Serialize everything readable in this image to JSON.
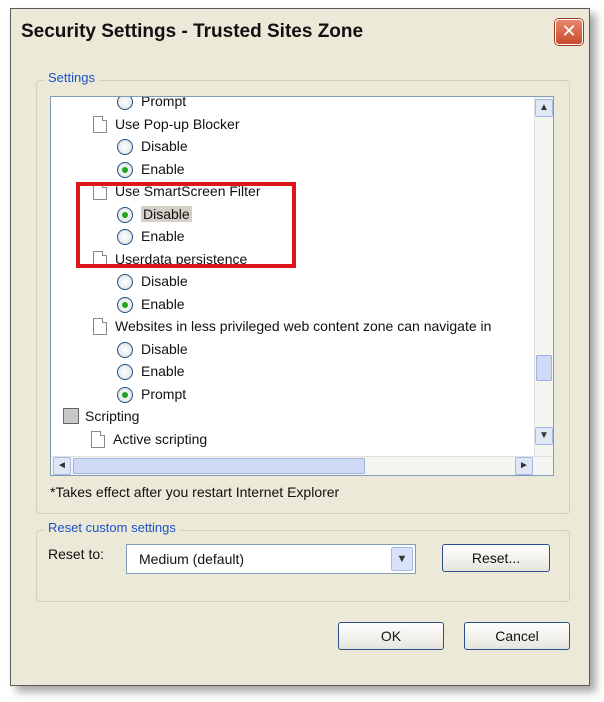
{
  "dialog": {
    "title": "Security Settings - Trusted Sites Zone",
    "close_label": "✕"
  },
  "settings": {
    "legend": "Settings",
    "items": [
      {
        "type": "radio",
        "label": "Prompt",
        "checked": false
      },
      {
        "type": "group",
        "label": "Use Pop-up Blocker"
      },
      {
        "type": "radio",
        "label": "Disable",
        "checked": false
      },
      {
        "type": "radio",
        "label": "Enable",
        "checked": true
      },
      {
        "type": "group",
        "label": "Use SmartScreen Filter"
      },
      {
        "type": "radio",
        "label": "Disable",
        "checked": true,
        "selected": true
      },
      {
        "type": "radio",
        "label": "Enable",
        "checked": false
      },
      {
        "type": "group",
        "label": "Userdata persistence"
      },
      {
        "type": "radio",
        "label": "Disable",
        "checked": false
      },
      {
        "type": "radio",
        "label": "Enable",
        "checked": true
      },
      {
        "type": "group",
        "label": "Websites in less privileged web content zone can navigate in"
      },
      {
        "type": "radio",
        "label": "Disable",
        "checked": false
      },
      {
        "type": "radio",
        "label": "Enable",
        "checked": false
      },
      {
        "type": "radio",
        "label": "Prompt",
        "checked": true
      },
      {
        "type": "category",
        "label": "Scripting"
      },
      {
        "type": "group",
        "label": "Active scripting"
      }
    ],
    "note": "*Takes effect after you restart Internet Explorer"
  },
  "reset": {
    "legend": "Reset custom settings",
    "label": "Reset to:",
    "selected": "Medium (default)",
    "button": "Reset..."
  },
  "footer": {
    "ok": "OK",
    "cancel": "Cancel"
  },
  "colors": {
    "highlight_box": "#e0161c",
    "legend_text": "#1a52c8",
    "dialog_bg": "#ece9d8"
  }
}
